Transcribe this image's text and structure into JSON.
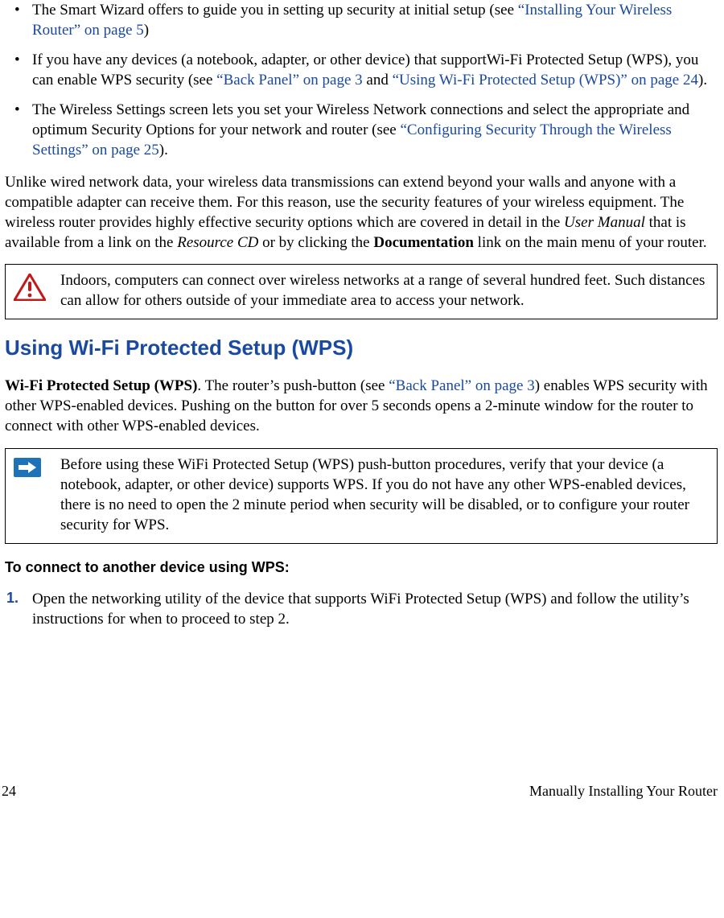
{
  "bullets": [
    {
      "before": "The Smart Wizard offers to guide you in setting up security at initial setup (see ",
      "link": "“Installing Your Wireless Router” on page 5",
      "after": ")"
    },
    {
      "before": "If you have any devices (a notebook, adapter, or other device) that supportWi-Fi Protected Setup (WPS), you can enable WPS security (see ",
      "link": "“Back Panel” on page 3",
      "mid": " and ",
      "link2": "“Using Wi-Fi Protected Setup (WPS)” on page 24",
      "after": ")."
    },
    {
      "before": "The Wireless Settings screen lets you set your Wireless Network connections and select the appropriate and optimum Security Options for your network and router (see ",
      "link": "“Configuring Security Through the Wireless Settings” on page 25",
      "after": ")."
    }
  ],
  "para1": {
    "p1": "Unlike wired network data, your wireless data transmissions can extend beyond your walls and anyone with a compatible adapter can receive them. For this reason, use the security features of your wireless equipment. The wireless router provides highly effective security options which are covered in detail in the ",
    "ital1": "User Manual",
    "p2": " that is available from a link on the ",
    "ital2": "Resource CD",
    "p3": " or by clicking the ",
    "bold1": "Documentation",
    "p4": " link on the main menu of your router."
  },
  "warning_text": "Indoors, computers can connect over wireless networks at a range of several hundred feet. Such distances can allow for others outside of your immediate area to access your network.",
  "section_title": "Using Wi-Fi Protected Setup (WPS)",
  "wps_para": {
    "bold": "Wi-Fi Protected Setup (WPS)",
    "p1": ". The router’s push-button (see ",
    "link": "“Back Panel” on page 3",
    "p2": ") enables WPS security with other WPS-enabled devices. Pushing on the button for over 5 seconds opens a 2-minute window for the router to connect with other WPS-enabled devices."
  },
  "note_text": "Before using these WiFi Protected Setup (WPS) push-button procedures, verify that your device (a notebook, adapter, or other device) supports WPS. If you do not have any other WPS-enabled devices, there is no need to open the 2 minute period when security will be disabled, or to configure your router security for WPS.",
  "sub_heading": "To connect to another device using WPS:",
  "steps": [
    {
      "num": "1.",
      "text": "Open the networking utility of the device that supports WiFi Protected Setup (WPS) and follow the utility’s instructions for when to proceed to step 2."
    }
  ],
  "footer": {
    "page": "24",
    "chapter": "Manually Installing Your Router"
  }
}
